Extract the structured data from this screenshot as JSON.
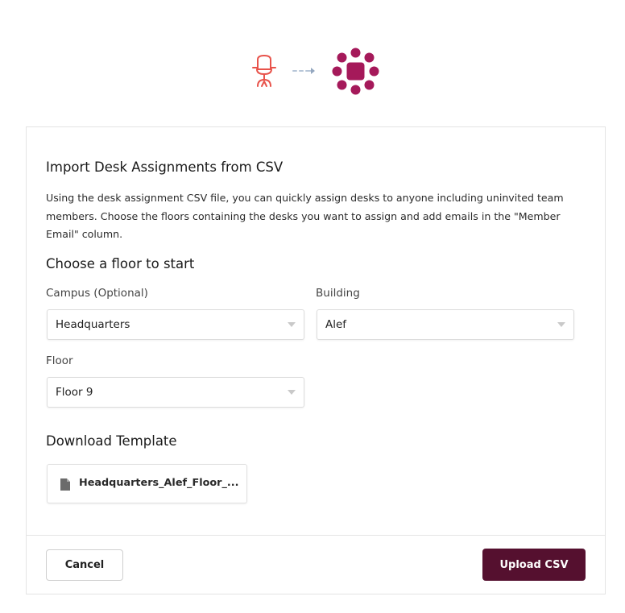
{
  "colors": {
    "chair_icon": "#e8534b",
    "arrow": "#b7c6d8",
    "app_icon": "#a5195a",
    "primary_button": "#55102f"
  },
  "icons": {
    "chair": "office-chair-icon",
    "arrow": "dashed-arrow-icon",
    "app": "integration-app-icon",
    "file": "document-icon"
  },
  "dialog": {
    "title": "Import Desk Assignments from CSV",
    "description": "Using the desk assignment CSV file, you can quickly assign desks to anyone including uninvited team members. Choose the floors containing the desks you want to assign and add emails in the \"Member Email\" column."
  },
  "floor_section": {
    "heading": "Choose a floor to start",
    "campus": {
      "label": "Campus (Optional)",
      "value": "Headquarters"
    },
    "building": {
      "label": "Building",
      "value": "Alef"
    },
    "floor": {
      "label": "Floor",
      "value": "Floor 9"
    }
  },
  "template_section": {
    "heading": "Download Template",
    "file_name": "Headquarters_Alef_Floor_..."
  },
  "footer": {
    "cancel_label": "Cancel",
    "upload_label": "Upload CSV"
  }
}
